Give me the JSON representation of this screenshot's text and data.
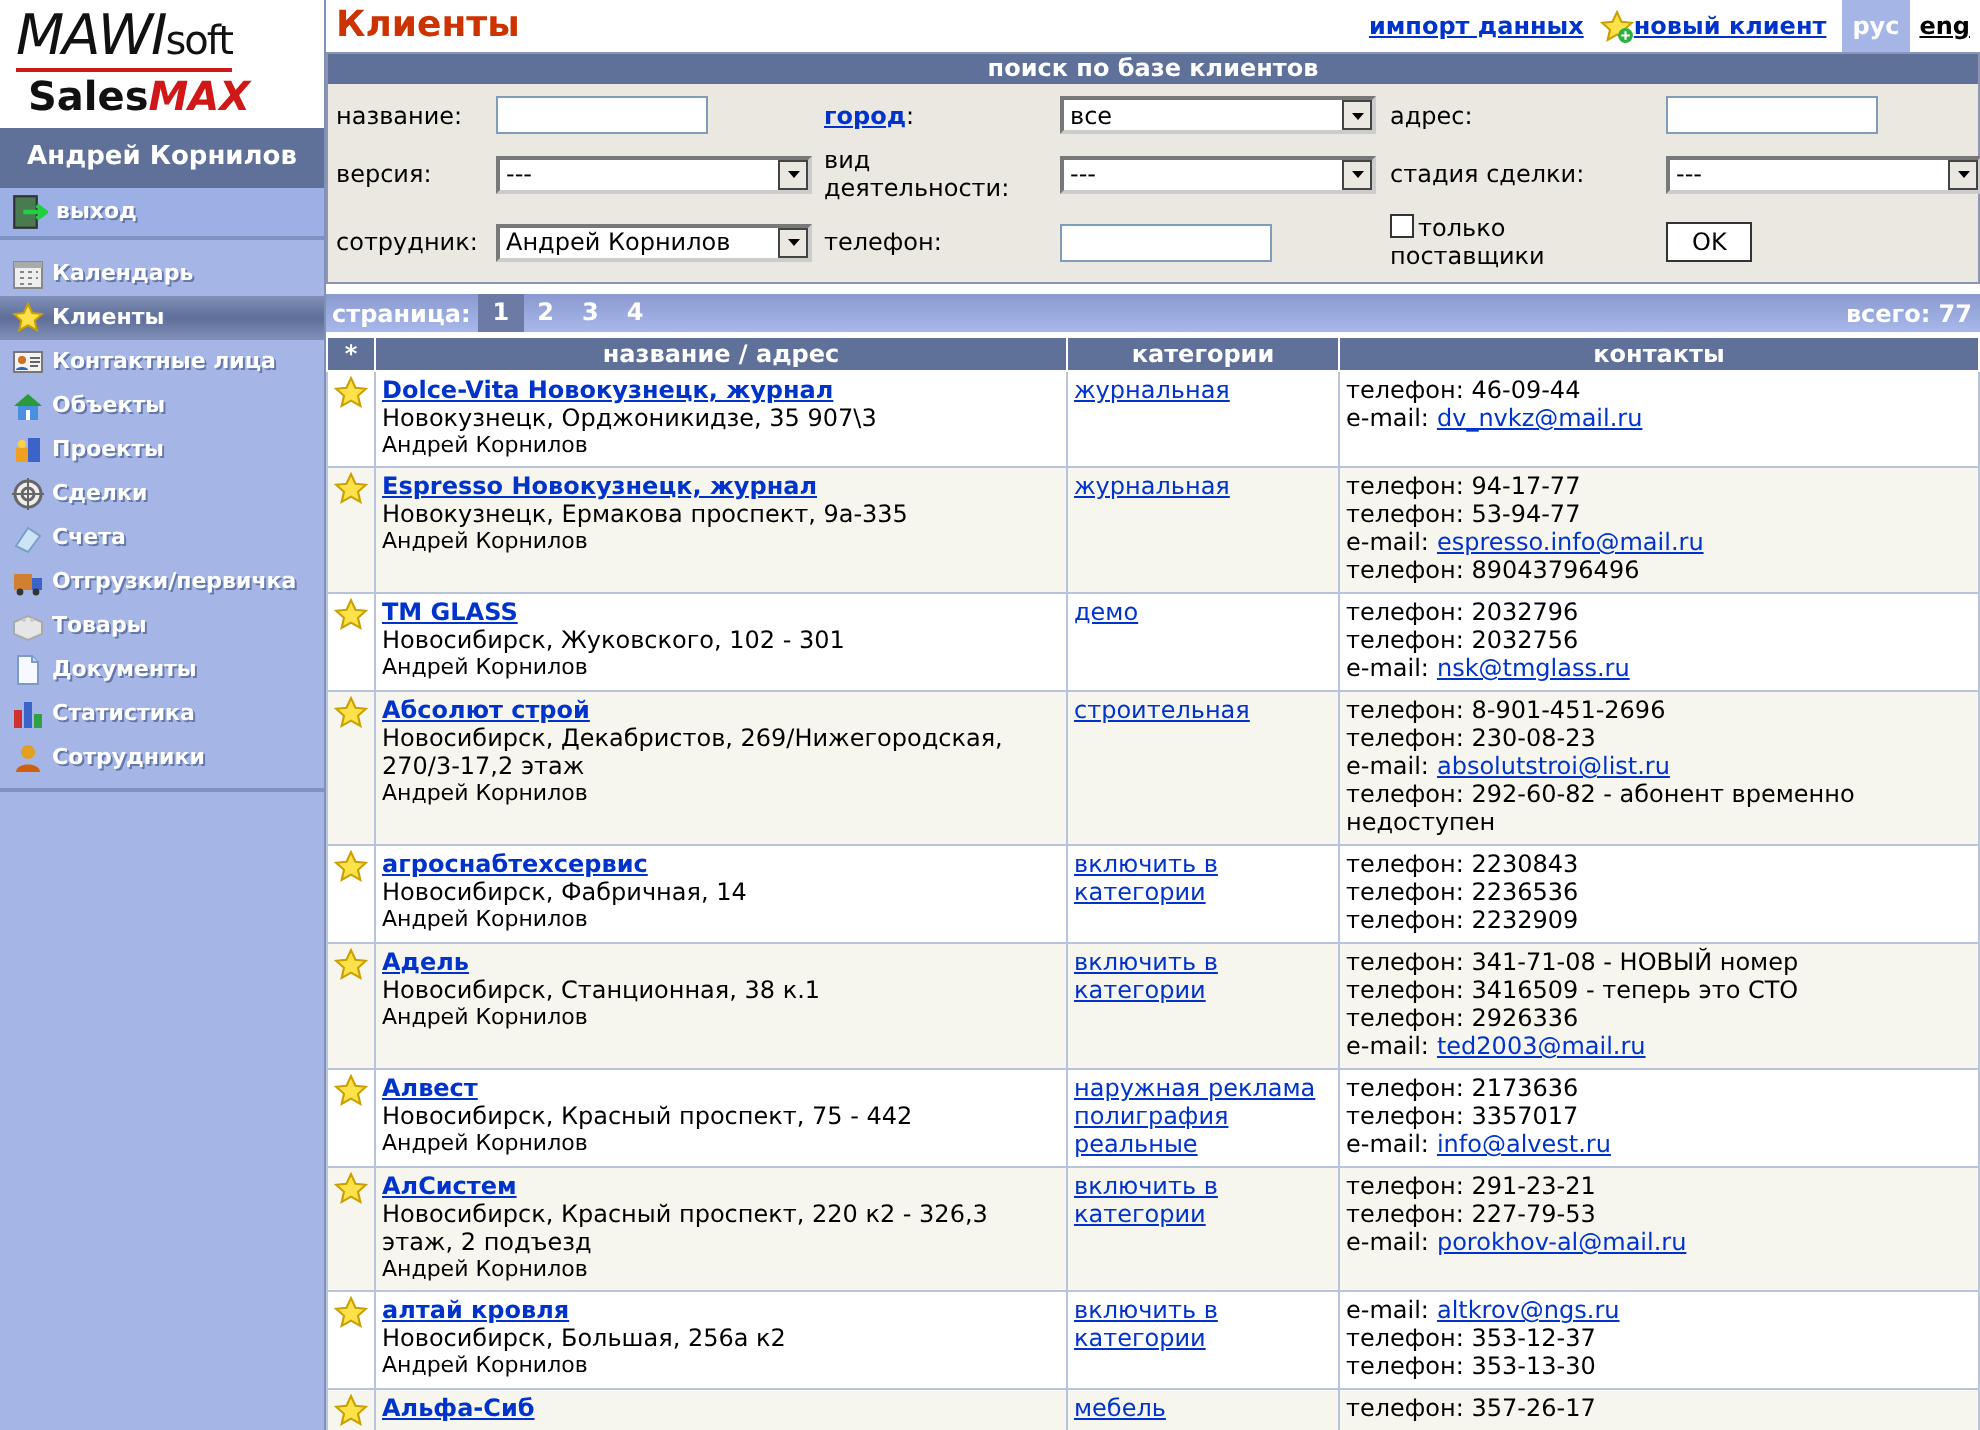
{
  "logo": {
    "top": "MAWI",
    "top_suffix": "soft",
    "bottom": "Sales",
    "bottom_bold": "MAX"
  },
  "user": {
    "name": "Андрей Корнилов"
  },
  "exit": {
    "label": "выход"
  },
  "sidebar": {
    "items": [
      {
        "label": "Календарь",
        "selected": false
      },
      {
        "label": "Клиенты",
        "selected": true
      },
      {
        "label": "Контактные лица",
        "selected": false
      },
      {
        "label": "Объекты",
        "selected": false
      },
      {
        "label": "Проекты",
        "selected": false
      },
      {
        "label": "Сделки",
        "selected": false
      },
      {
        "label": "Счета",
        "selected": false
      },
      {
        "label": "Отгрузки/первичка",
        "selected": false
      },
      {
        "label": "Товары",
        "selected": false
      },
      {
        "label": "Документы",
        "selected": false
      },
      {
        "label": "Статистика",
        "selected": false
      },
      {
        "label": "Сотрудники",
        "selected": false
      }
    ]
  },
  "page": {
    "title": "Клиенты",
    "links": [
      "импорт данных",
      "новый клиент"
    ],
    "languages": [
      {
        "label": "рус",
        "selected": true
      },
      {
        "label": "eng",
        "selected": false
      }
    ]
  },
  "search": {
    "title": "поиск по базе клиентов",
    "fields": [
      {
        "kind": "text",
        "label": "название:"
      },
      {
        "kind": "select",
        "label": "город",
        "label_is_link": true,
        "label_suffix": ":",
        "value": "все"
      },
      {
        "kind": "text",
        "label": "адрес:"
      },
      {
        "kind": "select",
        "label": "версия:",
        "value": "---"
      },
      {
        "kind": "select",
        "label": "вид деятельности:",
        "value": "---"
      },
      {
        "kind": "select",
        "label": "стадия сделки:",
        "value": "---"
      },
      {
        "kind": "select",
        "label": "сотрудник:",
        "value": "Андрей Корнилов"
      },
      {
        "kind": "text",
        "label": "телефон:"
      },
      {
        "kind": "checkbox",
        "label": "только поставщики",
        "checked": false
      },
      {
        "kind": "button",
        "label": "OK"
      }
    ]
  },
  "pagination": {
    "label": "страница:",
    "pages": [
      {
        "label": "1",
        "selected": true
      },
      {
        "label": "2",
        "selected": false
      },
      {
        "label": "3",
        "selected": false
      },
      {
        "label": "4",
        "selected": false
      }
    ],
    "total": "всего: 77"
  },
  "table": {
    "columns": [
      "*",
      "название / адрес",
      "категории",
      "контакты"
    ],
    "rows": [
      {
        "name": "Dolce-Vita Новокузнецк, журнал",
        "address": "Новокузнецк, Орджоникидзе, 35 907\\3",
        "owner": "Андрей Корнилов",
        "categories": [
          "журнальная"
        ],
        "contacts": [
          {
            "kind": "phone",
            "text": "телефон: 46-09-44"
          },
          {
            "kind": "email",
            "label": "e-mail:",
            "email": "dv_nvkz@mail.ru"
          }
        ]
      },
      {
        "name": "Espresso Новокузнецк, журнал",
        "address": "Новокузнецк, Ермакова проспект, 9а-335",
        "owner": "Андрей Корнилов",
        "categories": [
          "журнальная"
        ],
        "contacts": [
          {
            "kind": "phone",
            "text": "телефон: 94-17-77"
          },
          {
            "kind": "phone",
            "text": "телефон: 53-94-77"
          },
          {
            "kind": "email",
            "label": "e-mail:",
            "email": "espresso.info@mail.ru"
          },
          {
            "kind": "phone",
            "text": "телефон: 89043796496"
          }
        ]
      },
      {
        "name": "TM GLASS",
        "address": "Новосибирск, Жуковского, 102 - 301",
        "owner": "Андрей Корнилов",
        "categories": [
          "демо"
        ],
        "contacts": [
          {
            "kind": "phone",
            "text": "телефон: 2032796"
          },
          {
            "kind": "phone",
            "text": "телефон: 2032756"
          },
          {
            "kind": "email",
            "label": "e-mail:",
            "email": "nsk@tmglass.ru"
          }
        ]
      },
      {
        "name": "Абсолют строй",
        "address": "Новосибирск, Декабристов, 269/Нижегородская, 270/3-17,2 этаж",
        "owner": "Андрей Корнилов",
        "categories": [
          "строительная"
        ],
        "contacts": [
          {
            "kind": "phone",
            "text": "телефон: 8-901-451-2696"
          },
          {
            "kind": "phone",
            "text": "телефон: 230-08-23"
          },
          {
            "kind": "email",
            "label": "e-mail:",
            "email": "absolutstroi@list.ru"
          },
          {
            "kind": "phone",
            "text": "телефон: 292-60-82 - абонент временно недоступен"
          }
        ]
      },
      {
        "name": "агроснабтехсервис",
        "address": "Новосибирск, Фабричная, 14",
        "owner": "Андрей Корнилов",
        "categories": [
          "включить в категории"
        ],
        "contacts": [
          {
            "kind": "phone",
            "text": "телефон: 2230843"
          },
          {
            "kind": "phone",
            "text": "телефон: 2236536"
          },
          {
            "kind": "phone",
            "text": "телефон: 2232909"
          }
        ]
      },
      {
        "name": "Адель",
        "address": "Новосибирск, Станционная, 38 к.1",
        "owner": "Андрей Корнилов",
        "categories": [
          "включить в категории"
        ],
        "contacts": [
          {
            "kind": "phone",
            "text": "телефон: 341-71-08 - НОВЫЙ номер"
          },
          {
            "kind": "phone",
            "text": "телефон: 3416509 - теперь это СТО"
          },
          {
            "kind": "phone",
            "text": "телефон: 2926336"
          },
          {
            "kind": "email",
            "label": "e-mail:",
            "email": "ted2003@mail.ru"
          }
        ]
      },
      {
        "name": "Алвест",
        "address": "Новосибирск, Красный проспект, 75 - 442",
        "owner": "Андрей Корнилов",
        "categories": [
          "наружная реклама",
          "полиграфия",
          "реальные"
        ],
        "contacts": [
          {
            "kind": "phone",
            "text": "телефон: 2173636"
          },
          {
            "kind": "phone",
            "text": "телефон: 3357017"
          },
          {
            "kind": "email",
            "label": "e-mail:",
            "email": "info@alvest.ru"
          }
        ]
      },
      {
        "name": "АлСистем",
        "address": "Новосибирск, Красный проспект, 220 к2 - 326,3 этаж, 2 подъезд",
        "owner": "Андрей Корнилов",
        "categories": [
          "включить в категории"
        ],
        "contacts": [
          {
            "kind": "phone",
            "text": "телефон: 291-23-21"
          },
          {
            "kind": "phone",
            "text": "телефон: 227-79-53"
          },
          {
            "kind": "email",
            "label": "e-mail:",
            "email": "porokhov-al@mail.ru"
          }
        ]
      },
      {
        "name": "алтай кровля",
        "address": "Новосибирск, Большая, 256а к2",
        "owner": "Андрей Корнилов",
        "categories": [
          "включить в категории"
        ],
        "contacts": [
          {
            "kind": "email",
            "label": "e-mail:",
            "email": "altkrov@ngs.ru"
          },
          {
            "kind": "phone",
            "text": "телефон: 353-12-37"
          },
          {
            "kind": "phone",
            "text": "телефон: 353-13-30"
          }
        ]
      },
      {
        "name": "Альфа-Сиб",
        "categories": [
          "мебель"
        ],
        "contacts": [
          {
            "kind": "phone",
            "text": "телефон: 357-26-17"
          }
        ]
      }
    ]
  }
}
